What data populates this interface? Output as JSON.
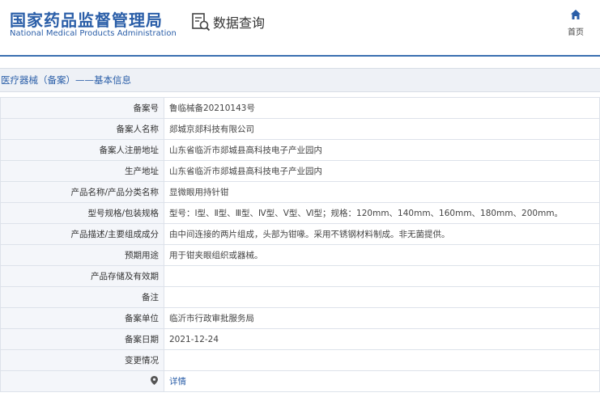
{
  "header": {
    "logo_cn": "国家药品监督管理局",
    "logo_en": "National Medical Products Administration",
    "query_label": "数据查询",
    "home_label": "首页"
  },
  "section_title": "医疗器械（备案）——基本信息",
  "rows": [
    {
      "label": "备案号",
      "value": "鲁临械备20210143号"
    },
    {
      "label": "备案人名称",
      "value": "郯城京郯科技有限公司"
    },
    {
      "label": "备案人注册地址",
      "value": "山东省临沂市郯城县高科技电子产业园内"
    },
    {
      "label": "生产地址",
      "value": "山东省临沂市郯城县高科技电子产业园内"
    },
    {
      "label": "产品名称/产品分类名称",
      "value": "显微眼用持针钳"
    },
    {
      "label": "型号规格/包装规格",
      "value": "型号：Ⅰ型、Ⅱ型、Ⅲ型、Ⅳ型、Ⅴ型、Ⅵ型；规格：120mm、140mm、160mm、180mm、200mm。"
    },
    {
      "label": "产品描述/主要组成成分",
      "value": "由中间连接的两片组成，头部为钳喙。采用不锈钢材料制成。非无菌提供。"
    },
    {
      "label": "预期用途",
      "value": "用于钳夹眼组织或器械。"
    },
    {
      "label": "产品存储及有效期",
      "value": ""
    },
    {
      "label": "备注",
      "value": ""
    },
    {
      "label": "备案单位",
      "value": "临沂市行政审批服务局"
    },
    {
      "label": "备案日期",
      "value": "2021-12-24"
    },
    {
      "label": "变更情况",
      "value": ""
    }
  ],
  "detail_row": {
    "link_label": "详情"
  },
  "colors": {
    "brand_blue": "#2a5ea8",
    "label_bg": "#f4f6fa",
    "section_bg": "#eef1f6"
  }
}
